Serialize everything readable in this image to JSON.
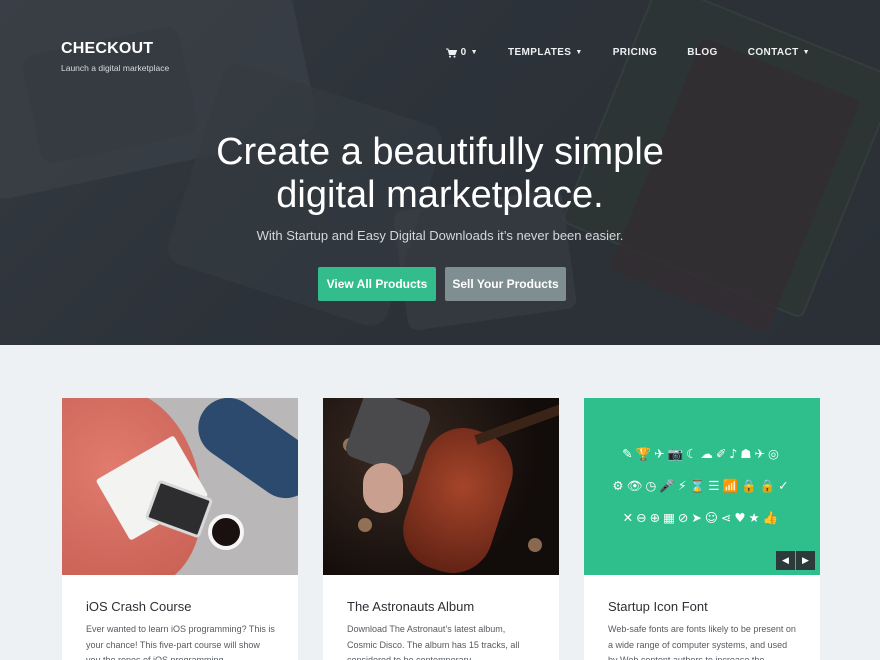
{
  "site": {
    "name": "CHECKOUT",
    "tagline": "Launch a digital marketplace"
  },
  "nav": {
    "cart_count": "0",
    "items": [
      "TEMPLATES",
      "PRICING",
      "BLOG",
      "CONTACT"
    ]
  },
  "hero": {
    "headline_line1": "Create a beautifully simple",
    "headline_line2": "digital marketplace.",
    "subline": "With Startup and Easy Digital Downloads it’s never been easier.",
    "primary_button": "View All Products",
    "secondary_button": "Sell Your Products"
  },
  "products": [
    {
      "title": "iOS Crash Course",
      "desc": "Ever wanted to learn iOS programming? This is your chance! This five-part course will show you the ropes of iOS programming."
    },
    {
      "title": "The Astronauts Album",
      "desc": "Download The Astronaut’s latest album, Cosmic Disco. The album has 15 tracks, all considered to be contemporary."
    },
    {
      "title": "Startup Icon Font",
      "desc": "Web-safe fonts are fonts likely to be present on a wide range of computer systems, and used by Web content authors to increase the"
    }
  ],
  "icon_font": {
    "row1": "✎🏆✈📷☾☁✐♪☗✈◎",
    "row2": "⚙👁◷🎤⚡⌛☰📶🔒🔒✓",
    "row3": "✕⊖⊕▦⊘➤☺⋖♥★👍"
  },
  "colors": {
    "accent": "#33bd8c",
    "secondary": "#7e8e91",
    "icon_bg": "#2fbf8d"
  }
}
